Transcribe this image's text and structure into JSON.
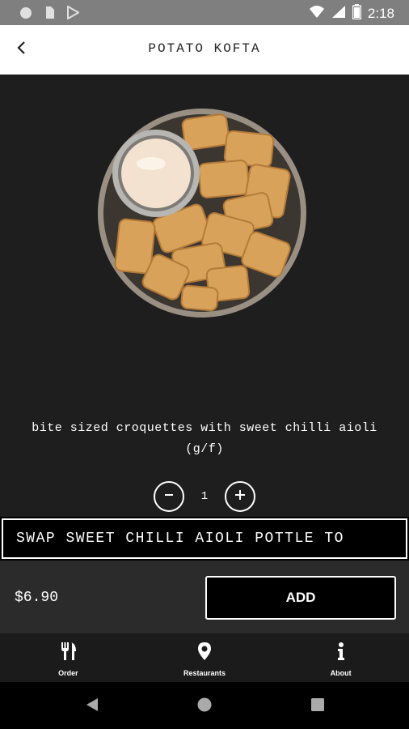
{
  "status_bar": {
    "time": "2:18",
    "icons": [
      "circle-notification-icon",
      "sim-card-icon",
      "play-store-icon",
      "wifi-icon",
      "signal-icon",
      "battery-icon"
    ]
  },
  "header": {
    "title": "POTATO KOFTA",
    "back_icon": "chevron-left-icon"
  },
  "item": {
    "image": "potato-kofta-bowl",
    "description": "bite sized croquettes with sweet chilli aioli (g/f)",
    "quantity": "1",
    "option_label": "SWAP SWEET CHILLI AIOLI POTTLE TO",
    "price": "$6.90",
    "add_label": "ADD"
  },
  "bottom_nav": {
    "items": [
      {
        "label": "Order",
        "icon": "fork-knife-icon"
      },
      {
        "label": "Restaurants",
        "icon": "map-pin-icon"
      },
      {
        "label": "About",
        "icon": "info-icon"
      }
    ]
  },
  "system_nav": {
    "icons": [
      "back-triangle-icon",
      "home-circle-icon",
      "recents-square-icon"
    ]
  },
  "colors": {
    "content_bg": "#1e1e1e",
    "header_bg": "#ffffff",
    "status_bar_bg": "#7f7f7f",
    "add_bar_bg": "#2b2b2b",
    "button_bg": "#000000",
    "text_light": "#ffffff"
  }
}
